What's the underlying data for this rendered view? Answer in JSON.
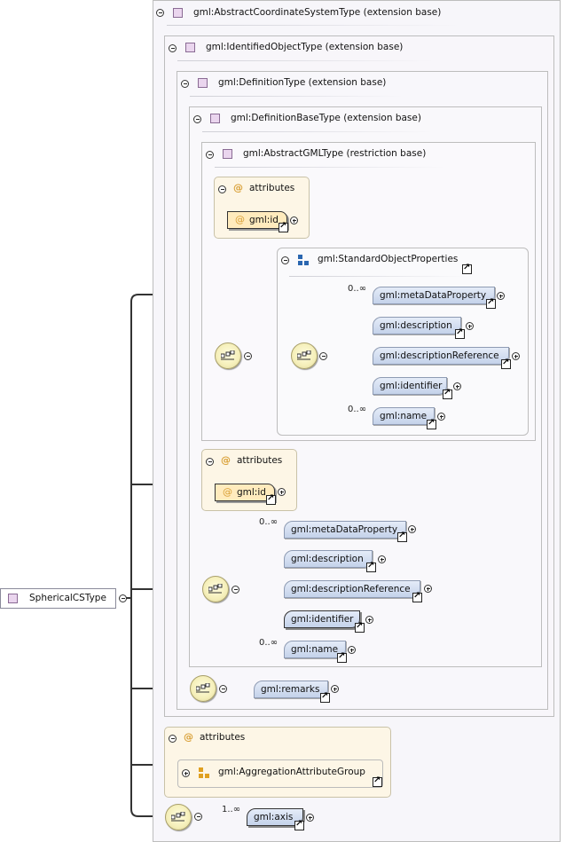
{
  "root": {
    "label": "SphericalCSType"
  },
  "frames": {
    "abstract_cs": "gml:AbstractCoordinateSystemType (extension base)",
    "identified": "gml:IdentifiedObjectType (extension base)",
    "definition": "gml:DefinitionType (extension base)",
    "definition_base": "gml:DefinitionBaseType (extension base)",
    "abstract_gml": "gml:AbstractGMLType (restriction base)"
  },
  "attributes_label": "attributes",
  "at_symbol": "@",
  "inner_attr": "gml:id",
  "outer_attr": "gml:id",
  "standard_props": "gml:StandardObjectProperties",
  "inner_seq": {
    "elements": [
      "gml:metaDataProperty",
      "gml:description",
      "gml:descriptionReference",
      "gml:identifier",
      "gml:name"
    ],
    "card_first": "0..∞",
    "card_last": "0..∞"
  },
  "outer_seq": {
    "elements": [
      "gml:metaDataProperty",
      "gml:description",
      "gml:descriptionReference",
      "gml:identifier",
      "gml:name"
    ],
    "card_first": "0..∞",
    "card_last": "0..∞"
  },
  "remarks": "gml:remarks",
  "aggregation": "gml:AggregationAttributeGroup",
  "axis": {
    "label": "gml:axis",
    "card": "1..∞"
  }
}
